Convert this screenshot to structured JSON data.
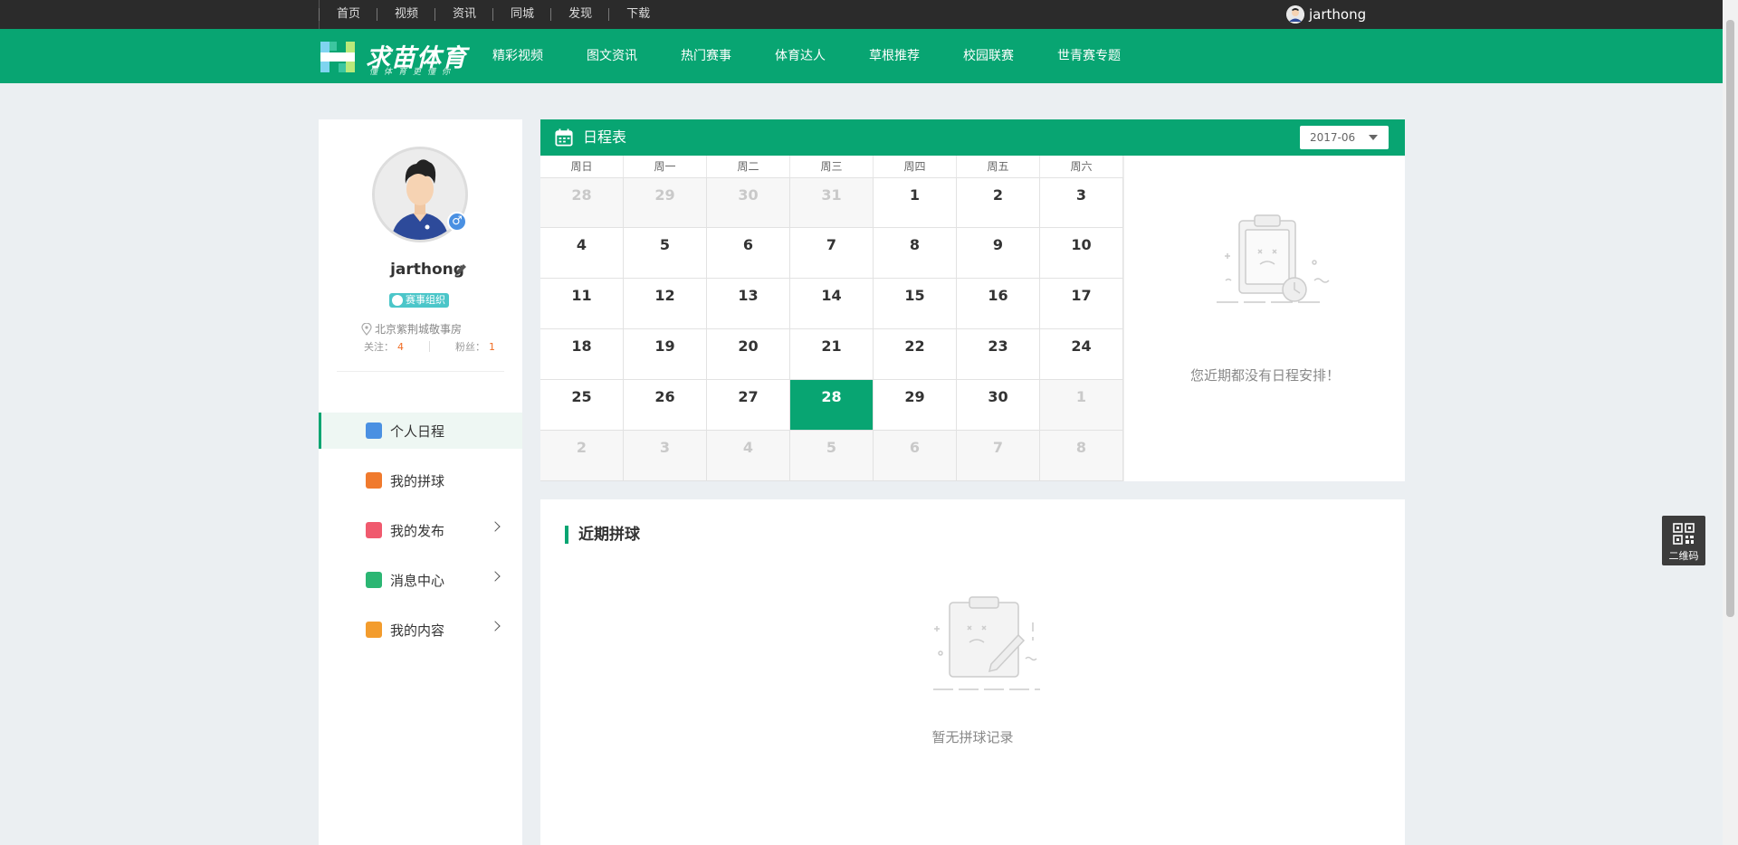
{
  "topbar": {
    "links": [
      "首页",
      "视频",
      "资讯",
      "同城",
      "发现",
      "下载"
    ],
    "username": "jarthong"
  },
  "header": {
    "logo_title": "求苗体育",
    "logo_slogan": "懂体育更懂你",
    "nav": [
      "精彩视频",
      "图文资讯",
      "热门赛事",
      "体育达人",
      "草根推荐",
      "校园联赛",
      "世青赛专题"
    ]
  },
  "profile": {
    "username": "jarthong",
    "role_badge": "赛事组织",
    "location": "北京紫荆城敬事房",
    "follow_label": "关注：",
    "follow_count": "4",
    "fans_label": "粉丝：",
    "fans_count": "1",
    "gender_symbol": "♂"
  },
  "menu": [
    {
      "label": "个人日程",
      "icon": "calendar-icon",
      "color": "#4a90e2",
      "active": true,
      "chevron": false
    },
    {
      "label": "我的拼球",
      "icon": "puzzle-icon",
      "color": "#f07a2d",
      "active": false,
      "chevron": false
    },
    {
      "label": "我的发布",
      "icon": "pencil-icon",
      "color": "#f05a6e",
      "active": false,
      "chevron": true
    },
    {
      "label": "消息中心",
      "icon": "message-icon",
      "color": "#2bb673",
      "active": false,
      "chevron": true
    },
    {
      "label": "我的内容",
      "icon": "grid-icon",
      "color": "#f39c2d",
      "active": false,
      "chevron": true
    }
  ],
  "calendar": {
    "title": "日程表",
    "month": "2017-06",
    "weekdays": [
      "周日",
      "周一",
      "周二",
      "周三",
      "周四",
      "周五",
      "周六"
    ],
    "weeks": [
      [
        {
          "d": "28",
          "o": true
        },
        {
          "d": "29",
          "o": true
        },
        {
          "d": "30",
          "o": true
        },
        {
          "d": "31",
          "o": true
        },
        {
          "d": "1"
        },
        {
          "d": "2"
        },
        {
          "d": "3"
        }
      ],
      [
        {
          "d": "4"
        },
        {
          "d": "5"
        },
        {
          "d": "6"
        },
        {
          "d": "7"
        },
        {
          "d": "8"
        },
        {
          "d": "9"
        },
        {
          "d": "10"
        }
      ],
      [
        {
          "d": "11"
        },
        {
          "d": "12"
        },
        {
          "d": "13"
        },
        {
          "d": "14"
        },
        {
          "d": "15"
        },
        {
          "d": "16"
        },
        {
          "d": "17"
        }
      ],
      [
        {
          "d": "18"
        },
        {
          "d": "19"
        },
        {
          "d": "20"
        },
        {
          "d": "21"
        },
        {
          "d": "22"
        },
        {
          "d": "23"
        },
        {
          "d": "24"
        }
      ],
      [
        {
          "d": "25"
        },
        {
          "d": "26"
        },
        {
          "d": "27"
        },
        {
          "d": "28",
          "t": true
        },
        {
          "d": "29"
        },
        {
          "d": "30"
        },
        {
          "d": "1",
          "o": true
        }
      ],
      [
        {
          "d": "2",
          "o": true
        },
        {
          "d": "3",
          "o": true
        },
        {
          "d": "4",
          "o": true
        },
        {
          "d": "5",
          "o": true
        },
        {
          "d": "6",
          "o": true
        },
        {
          "d": "7",
          "o": true
        },
        {
          "d": "8",
          "o": true
        }
      ]
    ],
    "empty_text": "您近期都没有日程安排！"
  },
  "recent": {
    "title": "近期拼球",
    "empty_text": "暂无拼球记录"
  },
  "qr": {
    "label": "二维码"
  },
  "colors": {
    "brand": "#08a572",
    "accent_orange": "#f06c23",
    "topbar": "#2b2b2b"
  }
}
